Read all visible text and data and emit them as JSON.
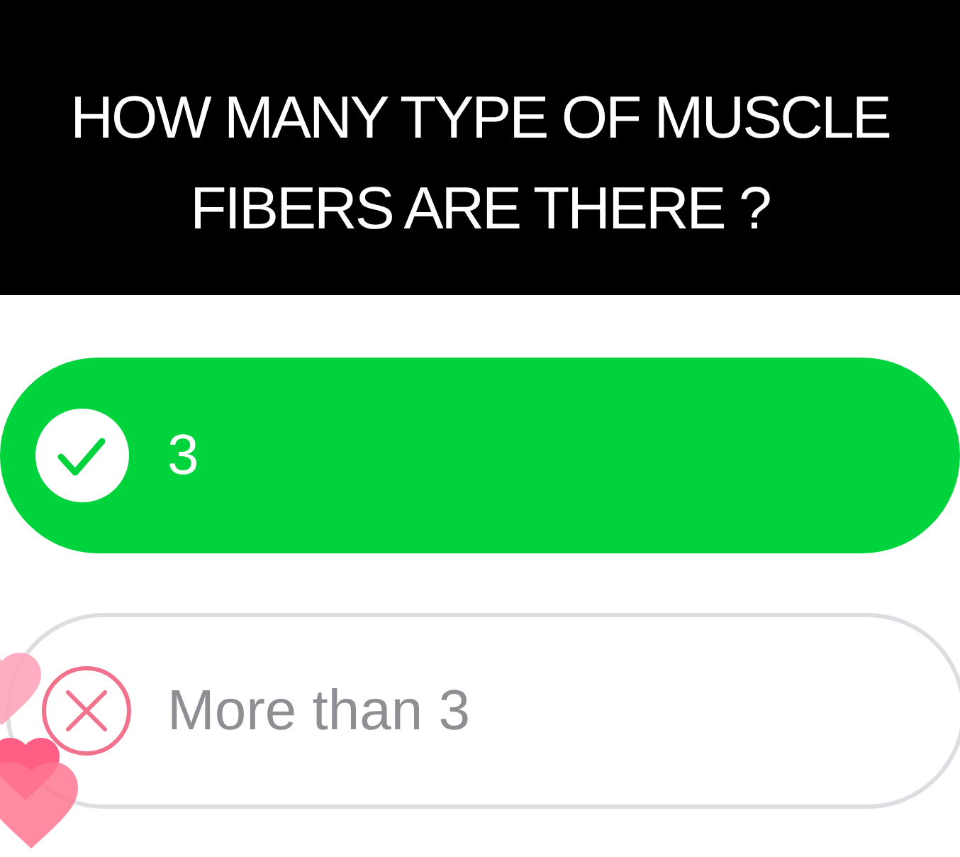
{
  "question": "HOW MANY TYPE OF MUSCLE FIBERS ARE THERE ?",
  "options": [
    {
      "label": "3",
      "correct": true
    },
    {
      "label": "More than 3",
      "correct": false
    }
  ]
}
